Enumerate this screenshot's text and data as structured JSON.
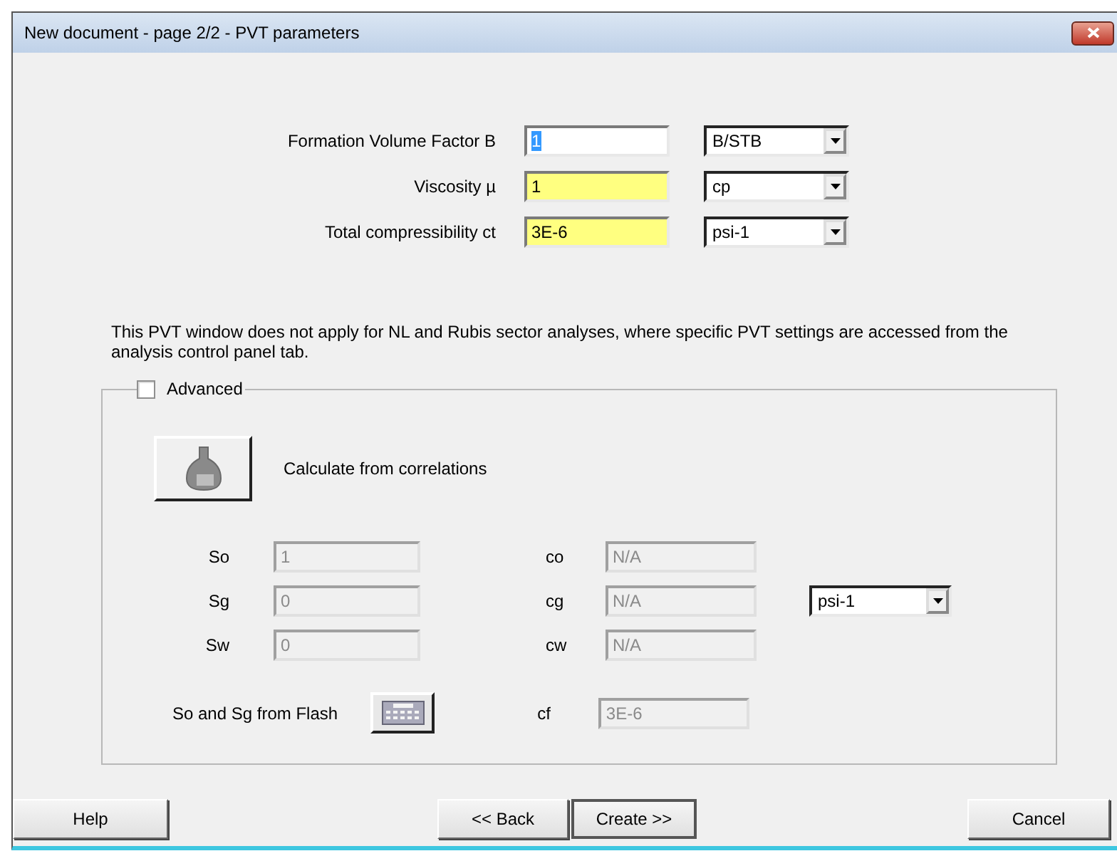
{
  "window": {
    "title": "New document - page 2/2 - PVT parameters"
  },
  "parameters": [
    {
      "label": "Formation Volume Factor B",
      "value": "1",
      "highlighted": false,
      "value_selected": true,
      "unit": "B/STB"
    },
    {
      "label": "Viscosity µ",
      "value": "1",
      "highlighted": true,
      "value_selected": false,
      "unit": "cp"
    },
    {
      "label": "Total compressibility ct",
      "value": "3E-6",
      "highlighted": true,
      "value_selected": false,
      "unit": "psi-1"
    }
  ],
  "note": "This PVT window does not apply for NL and Rubis sector analyses, where specific PVT settings are accessed from the analysis control panel tab.",
  "advanced": {
    "label": "Advanced",
    "checked": false,
    "correlations": {
      "label": "Calculate from correlations"
    },
    "saturations": [
      {
        "label": "So",
        "value": "1",
        "disabled": true
      },
      {
        "label": "Sg",
        "value": "0",
        "disabled": true
      },
      {
        "label": "Sw",
        "value": "0",
        "disabled": true
      }
    ],
    "compressibilities": [
      {
        "label": "co",
        "value": "N/A",
        "disabled": true
      },
      {
        "label": "cg",
        "value": "N/A",
        "disabled": true
      },
      {
        "label": "cw",
        "value": "N/A",
        "disabled": true
      }
    ],
    "compressibility_unit": "psi-1",
    "flash": {
      "label": "So and Sg from Flash"
    },
    "cf": {
      "label": "cf",
      "value": "3E-6",
      "disabled": true
    }
  },
  "buttons": [
    {
      "label": "Help",
      "default": false
    },
    {
      "label": "<< Back",
      "default": false
    },
    {
      "label": "Create >>",
      "default": true
    },
    {
      "label": "Cancel",
      "default": false
    }
  ]
}
